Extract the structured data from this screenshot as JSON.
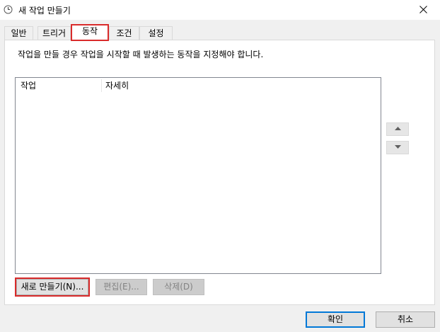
{
  "window": {
    "title": "새 작업 만들기",
    "icon": "clock-icon",
    "close_icon": "close-icon"
  },
  "tabs": [
    {
      "label": "일반",
      "active": false
    },
    {
      "label": "트리거",
      "active": false
    },
    {
      "label": "동작",
      "active": true
    },
    {
      "label": "조건",
      "active": false
    },
    {
      "label": "설정",
      "active": false
    }
  ],
  "actions_panel": {
    "description": "작업을 만들 경우 작업을 시작할 때 발생하는 동작을 지정해야 합니다.",
    "columns": [
      "작업",
      "자세히"
    ],
    "rows": [],
    "move_up_icon": "triangle-up-icon",
    "move_down_icon": "triangle-down-icon",
    "new_label": "새로 만들기(N)...",
    "edit_label": "편집(E)...",
    "delete_label": "삭제(D)"
  },
  "footer": {
    "ok_label": "확인",
    "cancel_label": "취소"
  },
  "colors": {
    "highlight": "#d92b2b",
    "default_button_border": "#0078d7",
    "dialog_background": "#f0f0f0"
  }
}
